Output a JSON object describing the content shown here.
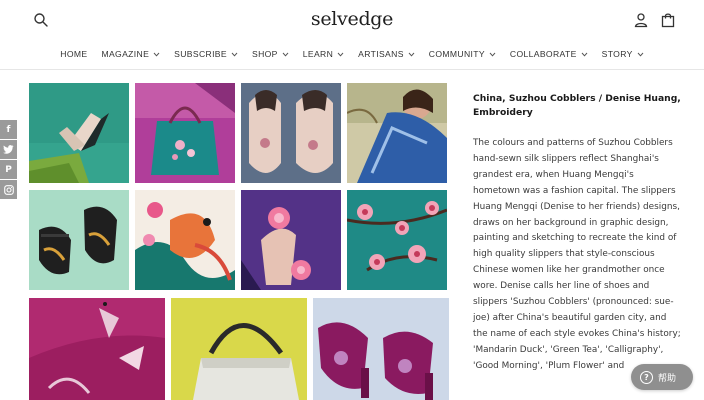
{
  "header": {
    "logo": "selvedge",
    "icons": {
      "search": "search-icon",
      "account": "user-icon",
      "cart": "shopping-bag-icon"
    }
  },
  "nav": {
    "home": "HOME",
    "magazine": "MAGAZINE",
    "subscribe": "SUBSCRIBE",
    "shop": "SHOP",
    "learn": "LEARN",
    "artisans": "ARTISANS",
    "community": "COMMUNITY",
    "collaborate": "COLLABORATE",
    "story": "STORY"
  },
  "social": {
    "facebook": "f",
    "twitter": "twitter-icon",
    "pinterest": "P",
    "instagram": "instagram-icon"
  },
  "article": {
    "title": "China, Suzhou Cobblers / Denise Huang, Embroidery",
    "body": "The colours and patterns of Suzhou Cobblers hand-sewn silk slippers reflect Shanghai's grandest era, when Huang Mengqi's hometown was a fashion capital. The slippers Huang Mengqi (Denise to her friends) designs, draws on her background in graphic design, painting and sketching to recreate the kind of high quality slippers that style-conscious Chinese women like her grandmother once wore. Denise calls her line of shoes and slippers 'Suzhou Cobblers' (pronounced: sue-joe) after China's beautiful garden city, and the name of each style evokes China's history; 'Mandarin Duck', 'Green Tea', 'Calligraphy', 'Good Morning', 'Plum Flower' and"
  },
  "help": {
    "label": "帮助",
    "icon": "question-icon"
  },
  "gallery": [
    "green-pointed-slipper-photo",
    "teal-bag-photo",
    "embroidered-flat-shoes-photo",
    "blue-fan-woman-photo",
    "black-mary-jane-photo",
    "orange-bird-embroidery-photo",
    "pink-flower-slippers-photo",
    "cherry-blossom-embroidery-photo",
    "magenta-silk-embroidery-photo",
    "yellow-bag-photo",
    "purple-heels-photo"
  ]
}
